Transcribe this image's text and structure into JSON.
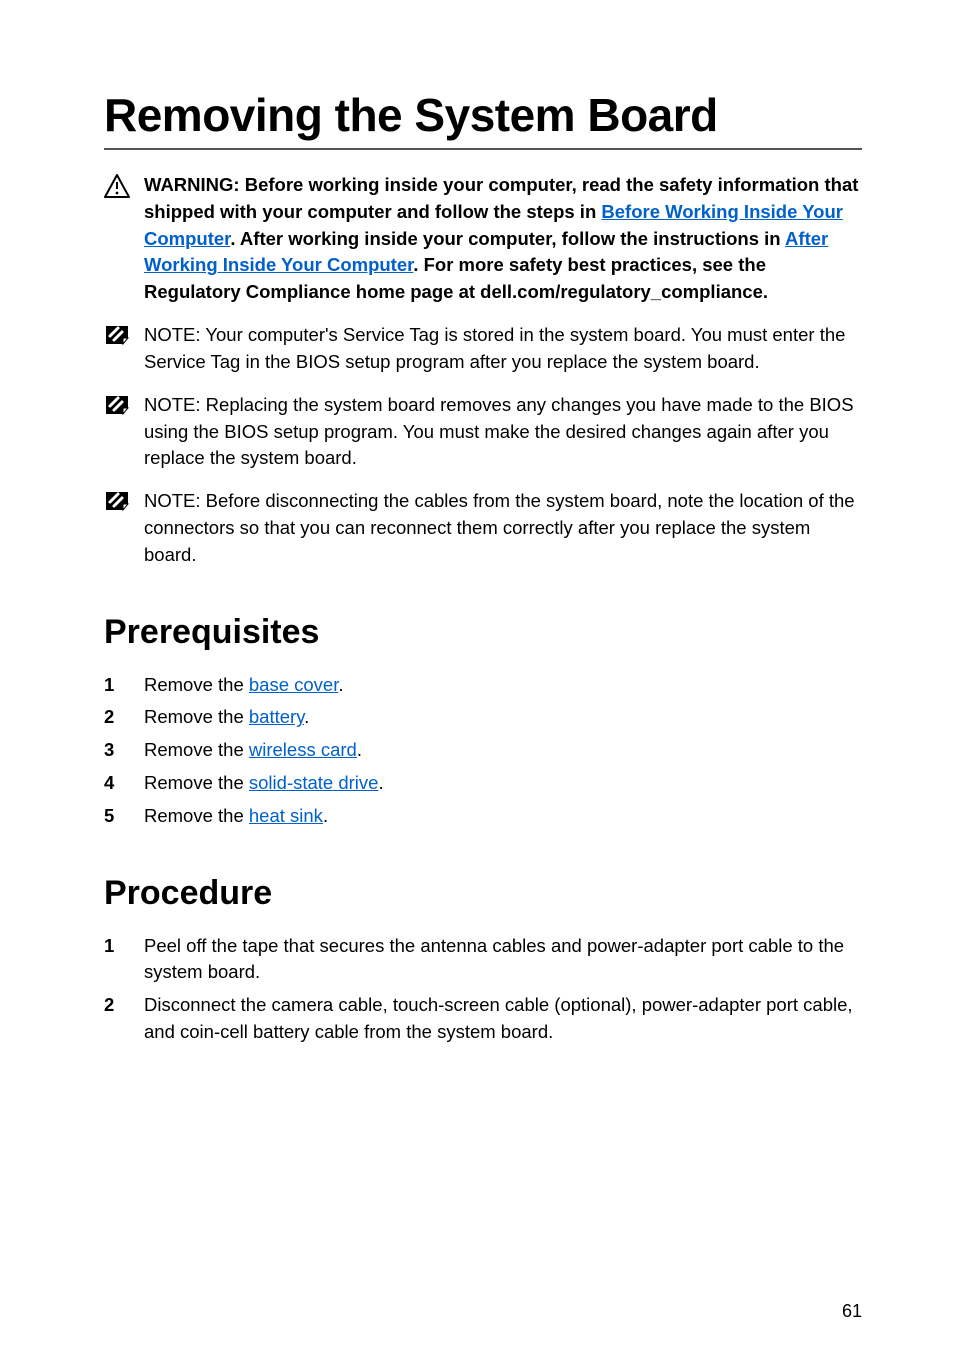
{
  "title": "Removing the System Board",
  "warning": {
    "pre": "WARNING: Before working inside your computer, read the safety information that shipped with your computer and follow the steps in ",
    "link1": "Before Working Inside Your Computer",
    "mid1": ". After working inside your computer, follow the instructions in ",
    "link2": "After Working Inside Your Computer",
    "post": ". For more safety best practices, see the Regulatory Compliance home page at dell.com/regulatory_compliance."
  },
  "notes": [
    {
      "label": "NOTE: ",
      "text": "Your computer's Service Tag is stored in the system board. You must enter the Service Tag in the BIOS setup program after you replace the system board."
    },
    {
      "label": "NOTE: ",
      "text": "Replacing the system board removes any changes you have made to the BIOS using the BIOS setup program. You must make the desired changes again after you replace the system board."
    },
    {
      "label": "NOTE: ",
      "text": "Before disconnecting the cables from the system board, note the location of the connectors so that you can reconnect them correctly after you replace the system board."
    }
  ],
  "sections": {
    "prereq": {
      "heading": "Prerequisites",
      "items": [
        {
          "pre": "Remove the ",
          "link": "base cover",
          "post": "."
        },
        {
          "pre": "Remove the ",
          "link": "battery",
          "post": "."
        },
        {
          "pre": "Remove the ",
          "link": "wireless card",
          "post": "."
        },
        {
          "pre": "Remove the ",
          "link": "solid-state drive",
          "post": "."
        },
        {
          "pre": "Remove the ",
          "link": "heat sink",
          "post": "."
        }
      ]
    },
    "procedure": {
      "heading": "Procedure",
      "items": [
        {
          "text": "Peel off the tape that secures the antenna cables and power-adapter port cable to the system board."
        },
        {
          "text": "Disconnect the camera cable, touch-screen cable (optional), power-adapter port cable, and coin-cell battery cable from the system board."
        }
      ]
    }
  },
  "page_number": "61"
}
